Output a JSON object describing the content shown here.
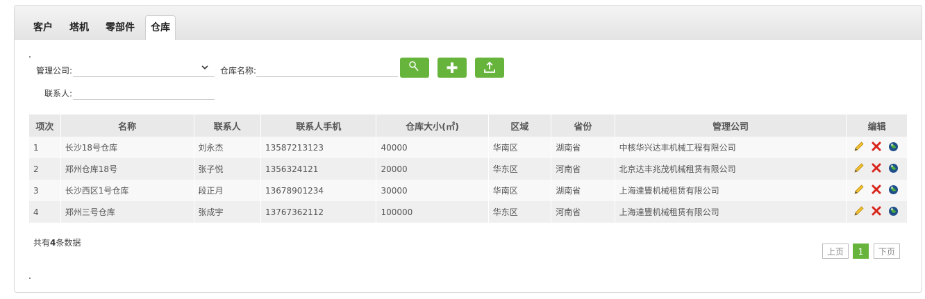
{
  "tabs": [
    "客户",
    "塔机",
    "零部件",
    "仓库"
  ],
  "filters": {
    "company_label": "管理公司:",
    "company_value": "",
    "warehouse_label": "仓库名称:",
    "warehouse_value": "",
    "contact_label": "联系人:",
    "contact_value": ""
  },
  "buttons": {
    "search_icon": "search-icon",
    "add_icon": "plus-icon",
    "export_icon": "upload-icon"
  },
  "table": {
    "headers": [
      "项次",
      "名称",
      "联系人",
      "联系人手机",
      "仓库大小(㎡)",
      "区域",
      "省份",
      "管理公司",
      "编辑"
    ],
    "rows": [
      [
        "1",
        "长沙18号仓库",
        "刘永杰",
        "13587213123",
        "40000",
        "华南区",
        "湖南省",
        "中核华兴达丰机械工程有限公司"
      ],
      [
        "2",
        "郑州仓库18号",
        "张子悦",
        "1356324121",
        "20000",
        "华东区",
        "河南省",
        "北京达丰兆茂机械租赁有限公司"
      ],
      [
        "3",
        "长沙西区1号仓库",
        "段正月",
        "13678901234",
        "30000",
        "华南区",
        "湖南省",
        "上海達豐机械租赁有限公司"
      ],
      [
        "4",
        "郑州三号仓库",
        "张成宇",
        "13767362112",
        "100000",
        "华东区",
        "河南省",
        "上海達豐机械租赁有限公司"
      ]
    ]
  },
  "summary": {
    "prefix": "共有",
    "count": "4",
    "suffix": "条数据"
  },
  "pagination": {
    "prev": "上页",
    "current": "1",
    "next": "下页"
  },
  "colors": {
    "accent": "#67b43c",
    "delete": "#d9261c"
  }
}
